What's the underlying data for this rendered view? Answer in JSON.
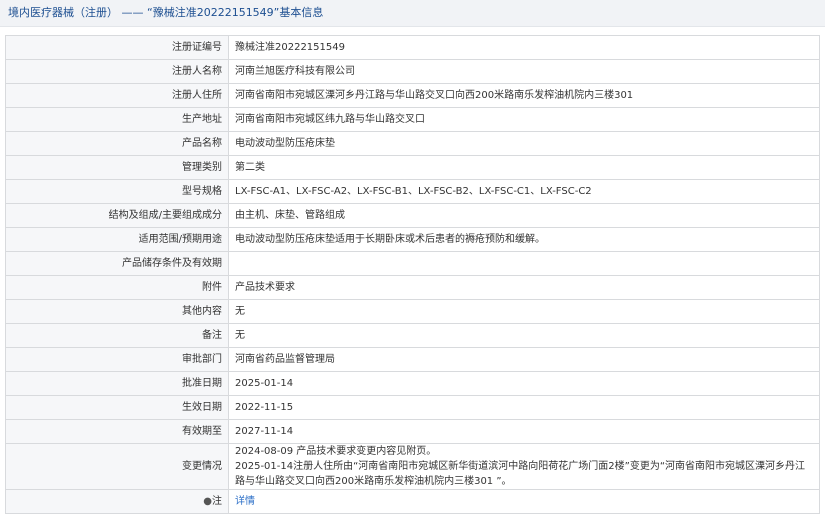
{
  "header": {
    "title": "境内医疗器械（注册）",
    "separator": "——",
    "subtitle": "“豫械注准20222151549”基本信息"
  },
  "rows": [
    {
      "key": "reg_no",
      "label": "注册证编号",
      "value": "豫械注准20222151549"
    },
    {
      "key": "registrant",
      "label": "注册人名称",
      "value": "河南兰旭医疗科技有限公司"
    },
    {
      "key": "registrant_address",
      "label": "注册人住所",
      "value": "河南省南阳市宛城区溧河乡丹江路与华山路交叉口向西200米路南乐发榨油机院内三楼301"
    },
    {
      "key": "production_address",
      "label": "生产地址",
      "value": "河南省南阳市宛城区纬九路与华山路交叉口"
    },
    {
      "key": "product_name",
      "label": "产品名称",
      "value": "电动波动型防压疮床垫"
    },
    {
      "key": "category",
      "label": "管理类别",
      "value": "第二类"
    },
    {
      "key": "models",
      "label": "型号规格",
      "value": "LX-FSC-A1、LX-FSC-A2、LX-FSC-B1、LX-FSC-B2、LX-FSC-C1、LX-FSC-C2"
    },
    {
      "key": "composition",
      "label": "结构及组成/主要组成成分",
      "value": "由主机、床垫、管路组成"
    },
    {
      "key": "scope",
      "label": "适用范围/预期用途",
      "value": "电动波动型防压疮床垫适用于长期卧床或术后患者的褥疮预防和缓解。"
    },
    {
      "key": "storage",
      "label": "产品储存条件及有效期",
      "value": ""
    },
    {
      "key": "attachments",
      "label": "附件",
      "value": "产品技术要求"
    },
    {
      "key": "other",
      "label": "其他内容",
      "value": "无"
    },
    {
      "key": "remarks",
      "label": "备注",
      "value": "无"
    },
    {
      "key": "approval_dept",
      "label": "审批部门",
      "value": "河南省药品监督管理局"
    },
    {
      "key": "approval_date",
      "label": "批准日期",
      "value": "2025-01-14"
    },
    {
      "key": "effective_date",
      "label": "生效日期",
      "value": "2022-11-15"
    },
    {
      "key": "expiry_date",
      "label": "有效期至",
      "value": "2027-11-14"
    }
  ],
  "changes": {
    "label": "变更情况",
    "lines": [
      "2024-08-09 产品技术要求变更内容见附页。",
      "2025-01-14注册人住所由“河南省南阳市宛城区新华街道滨河中路向阳荷花广场门面2楼”变更为“河南省南阳市宛城区溧河乡丹江",
      "路与华山路交叉口向西200米路南乐发榨油机院内三楼301 ”。"
    ]
  },
  "note": {
    "icon": "bullet-icon",
    "icon_glyph": "●",
    "label": "注",
    "link_text": "详情"
  },
  "colors": {
    "header_text": "#1d4f91",
    "label_bg": "#f6f7f9",
    "border": "#d8dadd",
    "link": "#2a6ec7"
  }
}
